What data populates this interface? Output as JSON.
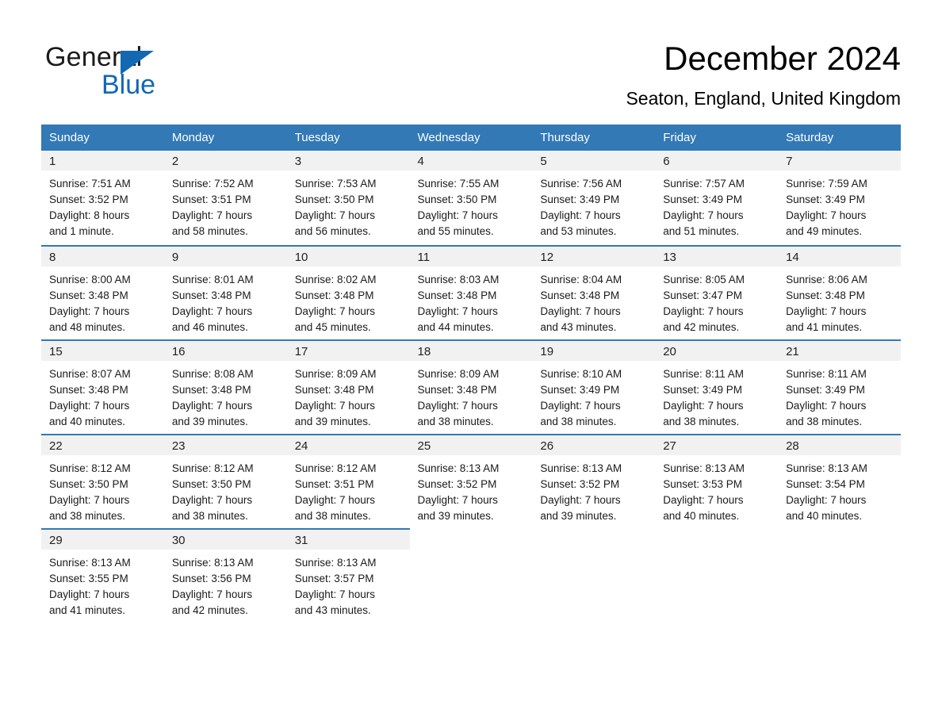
{
  "brand": {
    "name_top": "General",
    "name_bottom": "Blue",
    "accent_color": "#1268b3"
  },
  "header": {
    "title": "December 2024",
    "location": "Seaton, England, United Kingdom"
  },
  "theme": {
    "header_blue": "#3279b6",
    "daynum_band": "#f1f1f1",
    "text": "#1a1a1a"
  },
  "weekday_headers": [
    "Sunday",
    "Monday",
    "Tuesday",
    "Wednesday",
    "Thursday",
    "Friday",
    "Saturday"
  ],
  "weeks": [
    [
      {
        "day": "1",
        "sunrise": "Sunrise: 7:51 AM",
        "sunset": "Sunset: 3:52 PM",
        "daylight_1": "Daylight: 8 hours",
        "daylight_2": "and 1 minute."
      },
      {
        "day": "2",
        "sunrise": "Sunrise: 7:52 AM",
        "sunset": "Sunset: 3:51 PM",
        "daylight_1": "Daylight: 7 hours",
        "daylight_2": "and 58 minutes."
      },
      {
        "day": "3",
        "sunrise": "Sunrise: 7:53 AM",
        "sunset": "Sunset: 3:50 PM",
        "daylight_1": "Daylight: 7 hours",
        "daylight_2": "and 56 minutes."
      },
      {
        "day": "4",
        "sunrise": "Sunrise: 7:55 AM",
        "sunset": "Sunset: 3:50 PM",
        "daylight_1": "Daylight: 7 hours",
        "daylight_2": "and 55 minutes."
      },
      {
        "day": "5",
        "sunrise": "Sunrise: 7:56 AM",
        "sunset": "Sunset: 3:49 PM",
        "daylight_1": "Daylight: 7 hours",
        "daylight_2": "and 53 minutes."
      },
      {
        "day": "6",
        "sunrise": "Sunrise: 7:57 AM",
        "sunset": "Sunset: 3:49 PM",
        "daylight_1": "Daylight: 7 hours",
        "daylight_2": "and 51 minutes."
      },
      {
        "day": "7",
        "sunrise": "Sunrise: 7:59 AM",
        "sunset": "Sunset: 3:49 PM",
        "daylight_1": "Daylight: 7 hours",
        "daylight_2": "and 49 minutes."
      }
    ],
    [
      {
        "day": "8",
        "sunrise": "Sunrise: 8:00 AM",
        "sunset": "Sunset: 3:48 PM",
        "daylight_1": "Daylight: 7 hours",
        "daylight_2": "and 48 minutes."
      },
      {
        "day": "9",
        "sunrise": "Sunrise: 8:01 AM",
        "sunset": "Sunset: 3:48 PM",
        "daylight_1": "Daylight: 7 hours",
        "daylight_2": "and 46 minutes."
      },
      {
        "day": "10",
        "sunrise": "Sunrise: 8:02 AM",
        "sunset": "Sunset: 3:48 PM",
        "daylight_1": "Daylight: 7 hours",
        "daylight_2": "and 45 minutes."
      },
      {
        "day": "11",
        "sunrise": "Sunrise: 8:03 AM",
        "sunset": "Sunset: 3:48 PM",
        "daylight_1": "Daylight: 7 hours",
        "daylight_2": "and 44 minutes."
      },
      {
        "day": "12",
        "sunrise": "Sunrise: 8:04 AM",
        "sunset": "Sunset: 3:48 PM",
        "daylight_1": "Daylight: 7 hours",
        "daylight_2": "and 43 minutes."
      },
      {
        "day": "13",
        "sunrise": "Sunrise: 8:05 AM",
        "sunset": "Sunset: 3:47 PM",
        "daylight_1": "Daylight: 7 hours",
        "daylight_2": "and 42 minutes."
      },
      {
        "day": "14",
        "sunrise": "Sunrise: 8:06 AM",
        "sunset": "Sunset: 3:48 PM",
        "daylight_1": "Daylight: 7 hours",
        "daylight_2": "and 41 minutes."
      }
    ],
    [
      {
        "day": "15",
        "sunrise": "Sunrise: 8:07 AM",
        "sunset": "Sunset: 3:48 PM",
        "daylight_1": "Daylight: 7 hours",
        "daylight_2": "and 40 minutes."
      },
      {
        "day": "16",
        "sunrise": "Sunrise: 8:08 AM",
        "sunset": "Sunset: 3:48 PM",
        "daylight_1": "Daylight: 7 hours",
        "daylight_2": "and 39 minutes."
      },
      {
        "day": "17",
        "sunrise": "Sunrise: 8:09 AM",
        "sunset": "Sunset: 3:48 PM",
        "daylight_1": "Daylight: 7 hours",
        "daylight_2": "and 39 minutes."
      },
      {
        "day": "18",
        "sunrise": "Sunrise: 8:09 AM",
        "sunset": "Sunset: 3:48 PM",
        "daylight_1": "Daylight: 7 hours",
        "daylight_2": "and 38 minutes."
      },
      {
        "day": "19",
        "sunrise": "Sunrise: 8:10 AM",
        "sunset": "Sunset: 3:49 PM",
        "daylight_1": "Daylight: 7 hours",
        "daylight_2": "and 38 minutes."
      },
      {
        "day": "20",
        "sunrise": "Sunrise: 8:11 AM",
        "sunset": "Sunset: 3:49 PM",
        "daylight_1": "Daylight: 7 hours",
        "daylight_2": "and 38 minutes."
      },
      {
        "day": "21",
        "sunrise": "Sunrise: 8:11 AM",
        "sunset": "Sunset: 3:49 PM",
        "daylight_1": "Daylight: 7 hours",
        "daylight_2": "and 38 minutes."
      }
    ],
    [
      {
        "day": "22",
        "sunrise": "Sunrise: 8:12 AM",
        "sunset": "Sunset: 3:50 PM",
        "daylight_1": "Daylight: 7 hours",
        "daylight_2": "and 38 minutes."
      },
      {
        "day": "23",
        "sunrise": "Sunrise: 8:12 AM",
        "sunset": "Sunset: 3:50 PM",
        "daylight_1": "Daylight: 7 hours",
        "daylight_2": "and 38 minutes."
      },
      {
        "day": "24",
        "sunrise": "Sunrise: 8:12 AM",
        "sunset": "Sunset: 3:51 PM",
        "daylight_1": "Daylight: 7 hours",
        "daylight_2": "and 38 minutes."
      },
      {
        "day": "25",
        "sunrise": "Sunrise: 8:13 AM",
        "sunset": "Sunset: 3:52 PM",
        "daylight_1": "Daylight: 7 hours",
        "daylight_2": "and 39 minutes."
      },
      {
        "day": "26",
        "sunrise": "Sunrise: 8:13 AM",
        "sunset": "Sunset: 3:52 PM",
        "daylight_1": "Daylight: 7 hours",
        "daylight_2": "and 39 minutes."
      },
      {
        "day": "27",
        "sunrise": "Sunrise: 8:13 AM",
        "sunset": "Sunset: 3:53 PM",
        "daylight_1": "Daylight: 7 hours",
        "daylight_2": "and 40 minutes."
      },
      {
        "day": "28",
        "sunrise": "Sunrise: 8:13 AM",
        "sunset": "Sunset: 3:54 PM",
        "daylight_1": "Daylight: 7 hours",
        "daylight_2": "and 40 minutes."
      }
    ],
    [
      {
        "day": "29",
        "sunrise": "Sunrise: 8:13 AM",
        "sunset": "Sunset: 3:55 PM",
        "daylight_1": "Daylight: 7 hours",
        "daylight_2": "and 41 minutes."
      },
      {
        "day": "30",
        "sunrise": "Sunrise: 8:13 AM",
        "sunset": "Sunset: 3:56 PM",
        "daylight_1": "Daylight: 7 hours",
        "daylight_2": "and 42 minutes."
      },
      {
        "day": "31",
        "sunrise": "Sunrise: 8:13 AM",
        "sunset": "Sunset: 3:57 PM",
        "daylight_1": "Daylight: 7 hours",
        "daylight_2": "and 43 minutes."
      },
      {
        "day": "",
        "sunrise": "",
        "sunset": "",
        "daylight_1": "",
        "daylight_2": ""
      },
      {
        "day": "",
        "sunrise": "",
        "sunset": "",
        "daylight_1": "",
        "daylight_2": ""
      },
      {
        "day": "",
        "sunrise": "",
        "sunset": "",
        "daylight_1": "",
        "daylight_2": ""
      },
      {
        "day": "",
        "sunrise": "",
        "sunset": "",
        "daylight_1": "",
        "daylight_2": ""
      }
    ]
  ]
}
